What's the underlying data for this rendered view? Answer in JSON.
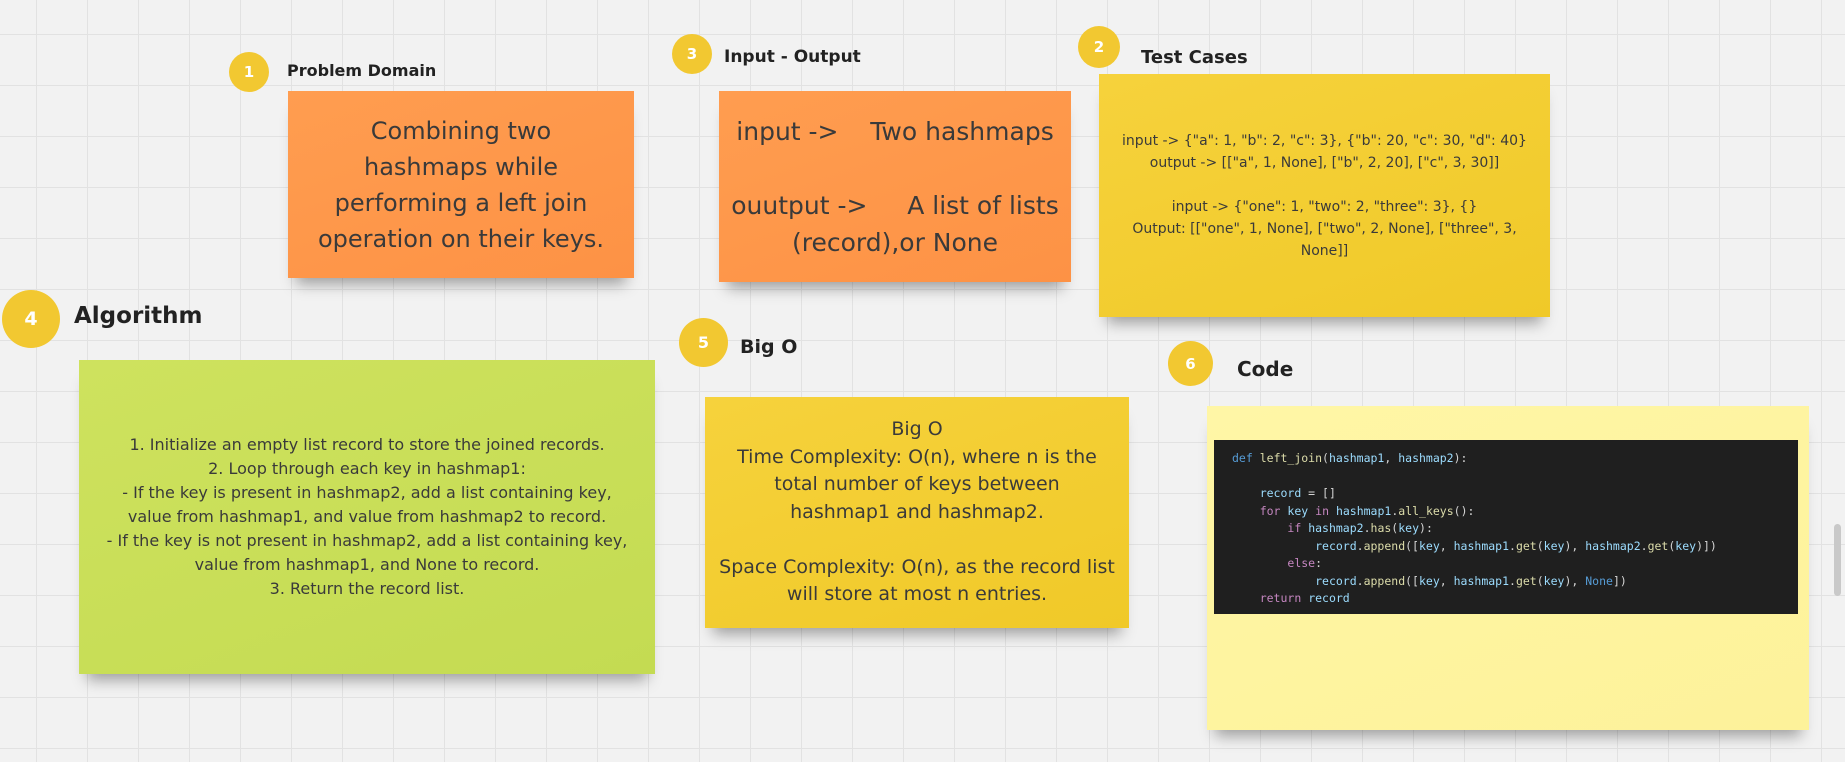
{
  "steps": {
    "problem_domain": {
      "number": "1",
      "title": "Problem Domain",
      "lines": [
        "Combining two",
        "hashmaps while",
        "performing a left join",
        "operation on their keys."
      ]
    },
    "input_output": {
      "number": "3",
      "title": "Input - Output",
      "lines": [
        "input ->    Two hashmaps",
        "",
        "ouutput ->     A list of lists",
        "(record),or None"
      ]
    },
    "test_cases": {
      "number": "2",
      "title": "Test Cases",
      "lines": [
        "input ->  {\"a\": 1, \"b\": 2, \"c\": 3}, {\"b\": 20, \"c\": 30, \"d\": 40}",
        "output ->   [[\"a\", 1, None], [\"b\", 2, 20], [\"c\", 3, 30]]",
        "",
        "input ->  {\"one\": 1, \"two\": 2, \"three\": 3}, {}",
        "Output:  [[\"one\", 1, None], [\"two\", 2, None], [\"three\", 3,",
        "None]]"
      ]
    },
    "algorithm": {
      "number": "4",
      "title": "Algorithm",
      "lines": [
        "1. Initialize an empty list record to store the joined records.",
        "2. Loop through each key in hashmap1:",
        "- If the key is present in hashmap2, add a list containing key,",
        "value from hashmap1, and value from hashmap2 to record.",
        "- If the key is not present in hashmap2, add a list containing key,",
        "value from hashmap1, and None to record.",
        "3. Return the record list."
      ]
    },
    "big_o": {
      "number": "5",
      "title": "Big O",
      "lines": [
        "Big O",
        "Time Complexity:  O(n), where n is the",
        "total number of keys between",
        "hashmap1 and hashmap2.",
        "",
        "Space Complexity: O(n), as the record list",
        "will store at most n entries."
      ]
    },
    "code": {
      "number": "6",
      "title": "Code",
      "lines": [
        "def left_join(hashmap1, hashmap2):",
        "",
        "    record = []",
        "    for key in hashmap1.all_keys():",
        "        if hashmap2.has(key):",
        "            record.append([key, hashmap1.get(key), hashmap2.get(key)])",
        "        else:",
        "            record.append([key, hashmap1.get(key), None])",
        "    return record"
      ]
    }
  },
  "colors": {
    "circle": "#f2c831",
    "orange": "#fd9a4a",
    "yellow": "#f2cc30",
    "green": "#c8de57",
    "pale": "#fff59e",
    "code_bg": "#1f1f1f"
  }
}
